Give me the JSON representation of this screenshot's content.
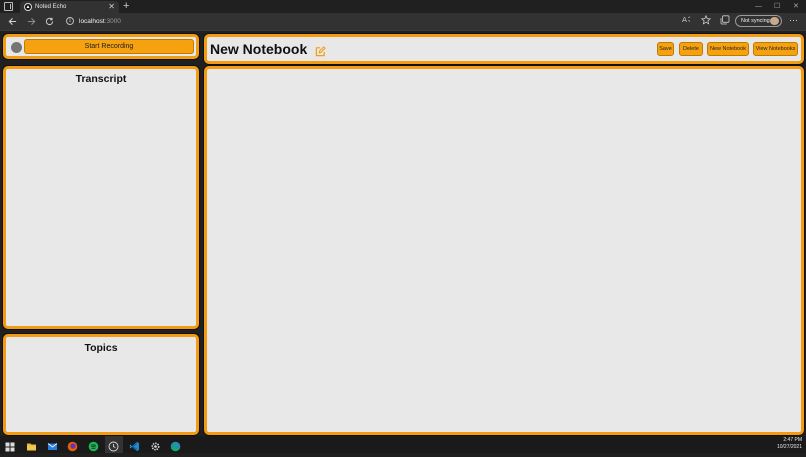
{
  "browser": {
    "tab_title": "Noted Echo",
    "tab_favicon_glyph": "▲",
    "close_glyph": "✕",
    "new_tab_glyph": "+",
    "url_host": "localhost",
    "url_port": ":3000",
    "sync_label": "Not syncing",
    "more_glyph": "···",
    "window_controls": {
      "minimize": "—",
      "maximize": "☐",
      "close": "✕"
    },
    "icons": [
      "tab-actions-icon",
      "back-arrow-icon",
      "forward-arrow-icon",
      "refresh-icon",
      "info-icon",
      "read-aloud-icon",
      "favorites-icon",
      "collections-icon",
      "profile-avatar",
      "more-icon"
    ]
  },
  "app": {
    "record_button_label": "Start Recording",
    "record_status_color": "#757575",
    "transcript_title": "Transcript",
    "topics_title": "Topics",
    "notebook_title": "New Notebook",
    "actions": {
      "save": "Save",
      "delete": "Delete",
      "new_notebook": "New Notebook",
      "view_notebooks": "View Notebooks"
    }
  },
  "colors": {
    "accent": "#f39c11",
    "button": "#f6a10f",
    "panel_bg": "#e8e8e8",
    "app_bg": "#202020"
  },
  "taskbar": {
    "time": "2:47 PM",
    "date": "10/27/2021",
    "apps": [
      "windows-start-icon",
      "file-explorer-icon",
      "mail-icon",
      "firefox-icon",
      "spotify-icon",
      "clock-app-icon",
      "vscode-icon",
      "settings-icon",
      "edge-icon"
    ]
  }
}
